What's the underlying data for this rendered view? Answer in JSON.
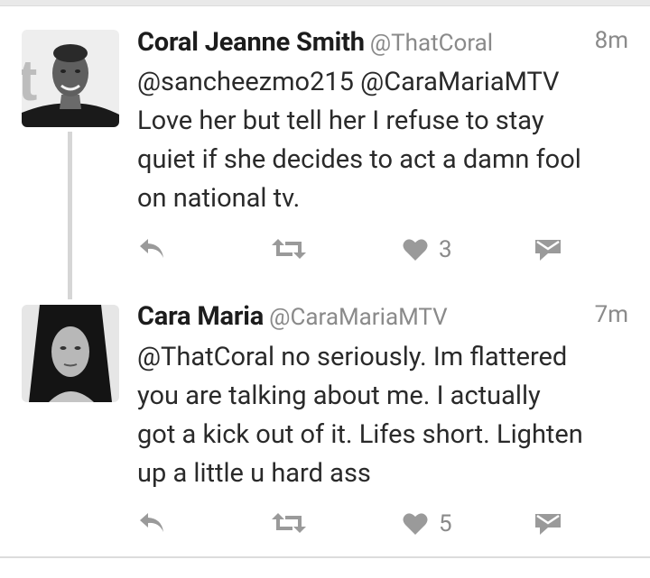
{
  "tweets": [
    {
      "author_name": "Coral Jeanne Smith",
      "handle": "@ThatCoral",
      "time": "8m",
      "text": "@sancheezmo215 @CaraMariaMTV\nLove her but tell her I refuse to stay\nquiet if she decides to act a damn fool\non national tv.",
      "like_count": "3",
      "avatar_icon": "profile-photo"
    },
    {
      "author_name": "Cara Maria",
      "handle": "@CaraMariaMTV",
      "time": "7m",
      "text": "@ThatCoral no seriously. Im flattered\nyou are talking about me. I actually\ngot a kick out of it. Lifes short. Lighten\nup a little u hard ass",
      "like_count": "5",
      "avatar_icon": "profile-photo"
    }
  ],
  "icons": {
    "reply": "reply-icon",
    "retweet": "retweet-icon",
    "like": "heart-icon",
    "message": "direct-message-icon"
  },
  "colors": {
    "icon_gray": "#9a9a9a",
    "text_gray": "#8a8a8a",
    "thread_line": "#d6d6d6"
  }
}
